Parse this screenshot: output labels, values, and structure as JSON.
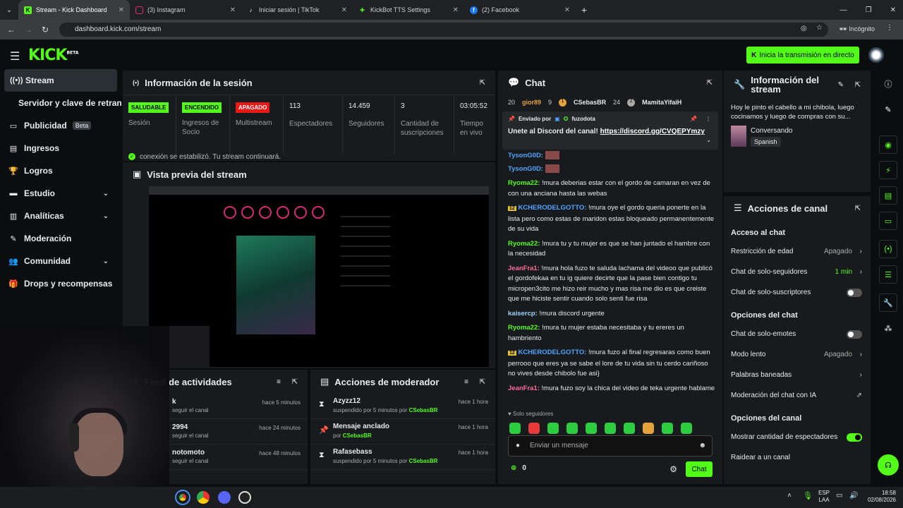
{
  "browser": {
    "tabs": [
      {
        "label": "Stream - Kick Dashboard",
        "icon": "kick-icon",
        "color": "#53fc18"
      },
      {
        "label": "(3) Instagram",
        "icon": "instagram-icon",
        "color": "#e1306c"
      },
      {
        "label": "Iniciar sesión | TikTok",
        "icon": "tiktok-icon",
        "color": "#ffffff"
      },
      {
        "label": "KickBot TTS Settings",
        "icon": "kickbot-icon",
        "color": "#53fc18"
      },
      {
        "label": "(2) Facebook",
        "icon": "facebook-icon",
        "color": "#1877f2"
      }
    ],
    "url": "dashboard.kick.com/stream",
    "incognito_label": "Incógnito"
  },
  "header": {
    "logo": "KICK",
    "logo_tag": "BETA",
    "go_live_label": "Inicia la transmisión en directo"
  },
  "sidebar": {
    "items": [
      {
        "label": "Stream",
        "icon": "stream-icon"
      },
      {
        "label": "Servidor y clave de retransmisión",
        "icon": ""
      },
      {
        "label": "Publicidad",
        "icon": "ads-icon",
        "badge": "Beta"
      },
      {
        "label": "Ingresos",
        "icon": "revenue-icon"
      },
      {
        "label": "Logros",
        "icon": "trophy-icon"
      },
      {
        "label": "Estudio",
        "icon": "studio-icon"
      },
      {
        "label": "Analíticas",
        "icon": "analytics-icon"
      },
      {
        "label": "Moderación",
        "icon": "moderation-icon"
      },
      {
        "label": "Comunidad",
        "icon": "community-icon"
      },
      {
        "label": "Drops y recompensas",
        "icon": "drops-icon"
      }
    ]
  },
  "session": {
    "title": "Información de la sesión",
    "stats": [
      {
        "badge": "SALUDABLE",
        "label": "Sesión",
        "badge_color": "#53fc18"
      },
      {
        "badge": "ENCENDIDO",
        "label": "Ingresos de Socio",
        "badge_color": "#53fc18"
      },
      {
        "badge": "APAGADO",
        "label": "Multistream",
        "badge_color": "#e91916"
      },
      {
        "value": "113",
        "label": "Espectadores"
      },
      {
        "value": "14.459",
        "label": "Seguidores"
      },
      {
        "value": "3",
        "label": "Cantidad de suscripciones"
      },
      {
        "value": "03:05:52",
        "label": "Tiempo en vivo"
      }
    ],
    "connection_msg": "conexión se estabilizó. Tu stream continuará."
  },
  "preview": {
    "title": "Vista previa del stream"
  },
  "feed": {
    "title": "Feed de actividades",
    "rows": [
      {
        "name": "k",
        "action": "seguir el canal",
        "time": "hace 5 minutos"
      },
      {
        "name": "2994",
        "action": "seguir el canal",
        "time": "hace 24 minutos"
      },
      {
        "name": "notomoto",
        "action": "seguir el canal",
        "time": "hace 48 minutos"
      }
    ]
  },
  "mod": {
    "title": "Acciones de moderador",
    "rows": [
      {
        "title": "Azyzz12",
        "sub": "suspendido por 5 minutos por",
        "by": "CSebasBR",
        "time": "hace 1 hora",
        "icon": "hourglass-icon"
      },
      {
        "title": "Mensaje anclado",
        "sub": "por",
        "by": "CSebasBR",
        "time": "hace 1 hora",
        "icon": "pin-icon"
      },
      {
        "title": "Rafasebass",
        "sub": "suspendido por 5 minutos por",
        "by": "CSebasBR",
        "time": "hace 1 hora",
        "icon": "hourglass-icon"
      }
    ]
  },
  "chat": {
    "title": "Chat",
    "top_users": [
      {
        "rank": "20",
        "name": "gior89",
        "count": "9"
      },
      {
        "rank": "1",
        "name": "CSebasBR",
        "count": "24"
      },
      {
        "rank": "2",
        "name": "MamitaYifaiH",
        "count": ""
      }
    ],
    "pinned_by_label": "Enviado por",
    "pinned_user": "fuzodota",
    "pinned_text": "Unete al Discord del canal!",
    "pinned_link": "https://discord.gg/CVQEPYmzy",
    "messages": [
      {
        "user": "TysonG0D:",
        "text": "",
        "color": "#4fa3ff"
      },
      {
        "user": "TysonG0D:",
        "text": "",
        "color": "#4fa3ff"
      },
      {
        "user": "Ryoma22:",
        "text": "!mura deberias estar con el gordo de camaran en vez de con una anciana hasta las webas",
        "color": "#53fc18"
      },
      {
        "user": "KCHERODELGOTTO:",
        "text": "!mura oye el gordo queria ponerte en la lista pero como estas de maridon estas bloqueado permanentemente de su vida",
        "color": "#4fa3ff",
        "badge": "12"
      },
      {
        "user": "Ryoma22:",
        "text": "!mura tu y tu mujer es que se han juntado el hambre con la necesidad",
        "color": "#53fc18"
      },
      {
        "user": "JeanFra1:",
        "text": "!mura hola fuzo te saluda lachama del videoo que publicó el gordofekaa en tu ig quiere decirte que la pase bien contigo tu micropen3cito me hizo reir mucho y mas risa me dio es que creiste que me hiciste sentir cuando solo senti fue risa",
        "color": "#ff6a9a"
      },
      {
        "user": "kaisercp:",
        "text": "!mura discord urgente",
        "color": "#9ed0ff"
      },
      {
        "user": "Ryoma22:",
        "text": "!mura tu mujer estaba necesitaba y tu ereres un hambriento",
        "color": "#53fc18"
      },
      {
        "user": "KCHERODELGOTTO:",
        "text": "!mura fuzo al final regresaras como buen perrooo que eres ya se sabe el lore de tu vida sin tu cerdo cariñoso no vives desde chibolo fue asi}",
        "color": "#4fa3ff",
        "badge": "12"
      },
      {
        "user": "JeanFra1:",
        "text": "!mura fuzo soy la chica del video de teka urgente hablame",
        "color": "#ff6a9a"
      }
    ],
    "followers_only": "Solo seguidores",
    "input_placeholder": "Enviar un mensaje",
    "points": "0",
    "send_label": "Chat"
  },
  "stream_info": {
    "title": "Información del stream",
    "stream_title": "Hoy le pinto el cabello a mi chibola, luego cocinamos y luego de compras con su...",
    "category": "Conversando",
    "language": "Spanish"
  },
  "channel_actions": {
    "title": "Acciones de canal",
    "sections": [
      {
        "heading": "Acceso al chat",
        "rows": [
          {
            "label": "Restricción de edad",
            "value": "Apagado",
            "kind": "arrow"
          },
          {
            "label": "Chat de solo-seguidores",
            "value": "1 min",
            "kind": "arrow-green"
          },
          {
            "label": "Chat de solo-suscriptores",
            "kind": "toggle-off"
          }
        ]
      },
      {
        "heading": "Opciones del chat",
        "rows": [
          {
            "label": "Chat de solo-emotes",
            "kind": "toggle-off"
          },
          {
            "label": "Modo lento",
            "value": "Apagado",
            "kind": "arrow"
          },
          {
            "label": "Palabras baneadas",
            "kind": "arrow"
          },
          {
            "label": "Moderación del chat con IA",
            "kind": "external"
          }
        ]
      },
      {
        "heading": "Opciones del canal",
        "rows": [
          {
            "label": "Mostrar cantidad de espectadores",
            "kind": "toggle-on"
          },
          {
            "label": "Raidear a un canal",
            "kind": "none"
          }
        ]
      }
    ]
  },
  "taskbar": {
    "lang": "ESP",
    "lang2": "LAA",
    "time": "18:58",
    "date": "02/08/2026"
  }
}
